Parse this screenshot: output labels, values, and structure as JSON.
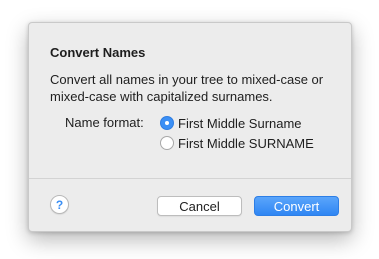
{
  "dialog": {
    "title": "Convert Names",
    "message": "Convert all names in your tree to mixed-case or mixed-case with capitalized surnames.",
    "format_label": "Name format:",
    "options": [
      {
        "label": "First Middle Surname",
        "selected": true
      },
      {
        "label": "First Middle SURNAME",
        "selected": false
      }
    ],
    "help_glyph": "?",
    "cancel_label": "Cancel",
    "convert_label": "Convert"
  },
  "colors": {
    "accent": "#3b8ff5",
    "dialog_bg": "#ececec",
    "primary_button": "#2f86f3"
  },
  "icons": {
    "help": "help-icon"
  }
}
